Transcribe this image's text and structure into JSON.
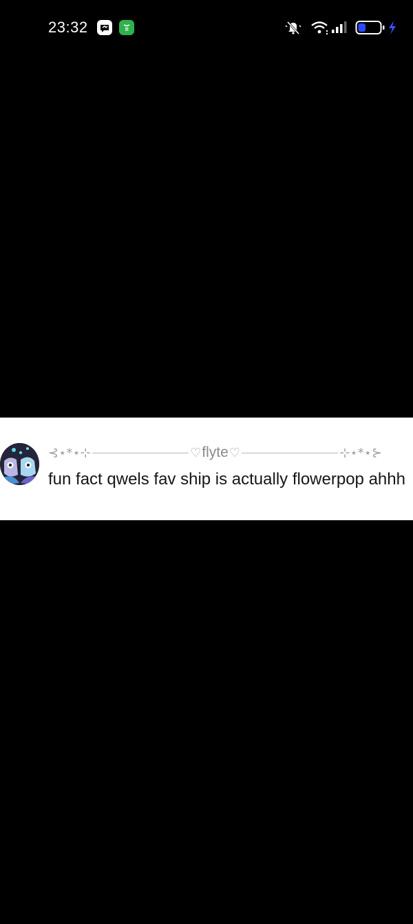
{
  "status_bar": {
    "time": "23:32",
    "left_icons": [
      "messenger-app-icon",
      "wechat-app-icon"
    ],
    "right_icons": [
      "mute-bell-icon",
      "wifi-icon",
      "signal-icon",
      "battery-icon",
      "charging-bolt-icon"
    ],
    "battery_level": 0.35
  },
  "comment": {
    "decor_left": "⊰⋆*⋆⊹",
    "username_open": "♡",
    "username": "flyte",
    "username_close": "♡",
    "decor_right": "⊹⋆*⋆⊱",
    "text": "fun fact qwels fav ship is actually flowerpop ahhh"
  },
  "colors": {
    "background": "#000000",
    "card": "#ffffff",
    "text": "#161616",
    "username": "#8a8a8a",
    "battery_fill": "#2d49ff",
    "charging": "#3a52ff",
    "wechat_green": "#2fb24c"
  }
}
